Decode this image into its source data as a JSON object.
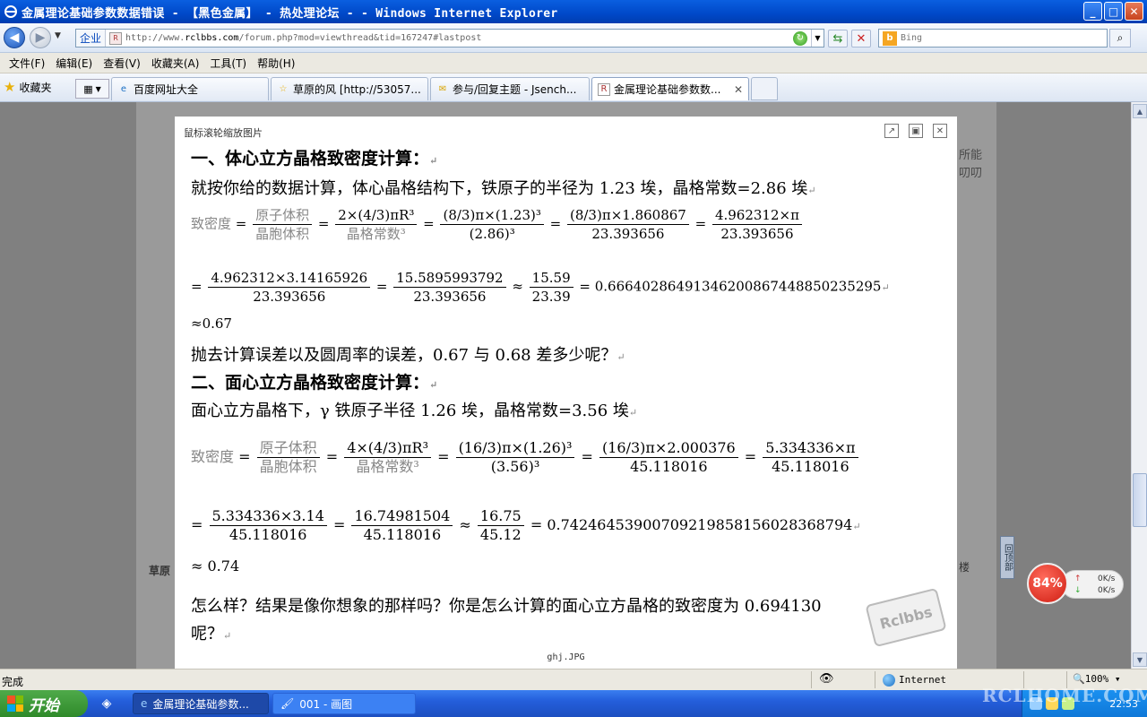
{
  "window": {
    "title": "金属理论基础参数数据错误 - 【黑色金属】 - 热处理论坛 - - Windows Internet Explorer"
  },
  "address": {
    "zone": "企业",
    "url_prefix": "http://www.",
    "url_domain": "rclbbs.com",
    "url_path": "/forum.php?mod=viewthread&tid=167247#lastpost"
  },
  "search": {
    "placeholder": "Bing"
  },
  "menu": [
    "文件(F)",
    "编辑(E)",
    "查看(V)",
    "收藏夹(A)",
    "工具(T)",
    "帮助(H)"
  ],
  "favorites": {
    "label": "收藏夹"
  },
  "tabs": [
    {
      "label": "百度网址大全"
    },
    {
      "label": "草原的风 [http://53057..."
    },
    {
      "label": "参与/回复主题 - Jsench..."
    },
    {
      "label": "金属理论基础参数数..."
    }
  ],
  "viewer": {
    "hint": "鼠标滚轮缩放图片",
    "filename": "ghj.JPG",
    "stamp": "Rclbbs"
  },
  "background": {
    "username": "草原",
    "floor": "楼",
    "side_text": [
      "所能",
      "叨叨"
    ],
    "top_button": "回顶部"
  },
  "doc": {
    "h1": "一、体心立方晶格致密度计算：",
    "p1": "就按你给的数据计算，体心晶格结构下，铁原子的半径为 1.23 埃，晶格常数=2.86 埃",
    "bcc": {
      "lhs": "致密度",
      "f1n": "原子体积",
      "f1d": "晶胞体积",
      "f2n": "2×(4/3)πR³",
      "f2d": "晶格常数³",
      "f3n": "(8/3)π×(1.23)³",
      "f3d": "(2.86)³",
      "f4n": "(8/3)π×1.860867",
      "f4d": "23.393656",
      "f5n": "4.962312×π",
      "f5d": "23.393656",
      "f6n": "4.962312×3.14165926",
      "f6d": "23.393656",
      "f7n": "15.5895993792",
      "f7d": "23.393656",
      "f8n": "15.59",
      "f8d": "23.39",
      "result": "= 0.66640286491346200867448850235295",
      "approx": "≈0.67"
    },
    "p2": "抛去计算误差以及圆周率的误差，0.67 与 0.68 差多少呢？",
    "h2": "二、面心立方晶格致密度计算：",
    "p3": "面心立方晶格下，γ 铁原子半径 1.26 埃，晶格常数=3.56 埃",
    "fcc": {
      "lhs": "致密度",
      "f1n": "原子体积",
      "f1d": "晶胞体积",
      "f2n": "4×(4/3)πR³",
      "f2d": "晶格常数³",
      "f3n": "(16/3)π×(1.26)³",
      "f3d": "(3.56)³",
      "f4n": "(16/3)π×2.000376",
      "f4d": "45.118016",
      "f5n": "5.334336×π",
      "f5d": "45.118016",
      "f6n": "5.334336×3.14",
      "f6d": "45.118016",
      "f7n": "16.74981504",
      "f7d": "45.118016",
      "f8n": "16.75",
      "f8d": "45.12",
      "result": "= 0.74246453900709219858156028368794",
      "approx": "≈ 0.74"
    },
    "p4": "怎么样？结果是像你想象的那样吗？你是怎么计算的面心立方晶格的致密度为 0.694130",
    "p5": "呢？"
  },
  "speed": {
    "percent": "84%",
    "up": "0K/s",
    "down": "0K/s"
  },
  "status": {
    "text": "完成",
    "zone": "Internet",
    "zoom": "100%"
  },
  "taskbar": {
    "start": "开始",
    "tasks": [
      {
        "label": "金属理论基础参数..."
      },
      {
        "label": "001 - 画图"
      }
    ],
    "clock": "22:53"
  },
  "watermark": "RCLHOME.COM"
}
